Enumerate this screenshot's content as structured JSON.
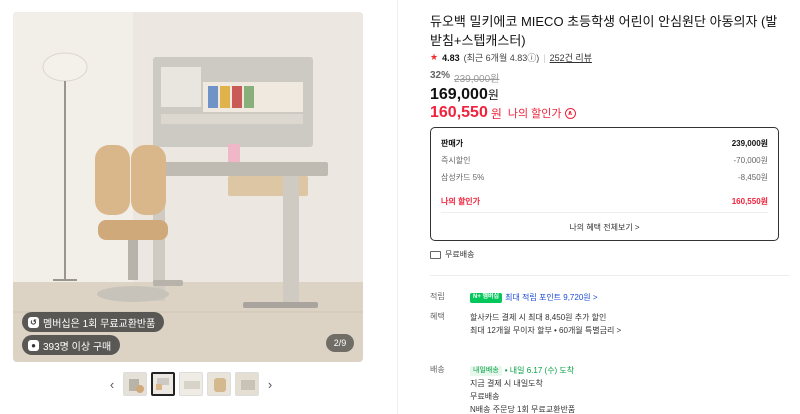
{
  "product": {
    "title": "듀오백 밀키에코 MIECO 초등학생 어린이 안심원단 아동의자 (발받침+스텝캐스터)",
    "rating_score": "4.83",
    "rating_detail": "(최근 6개월 4.83ⓘ)",
    "review_count": "252건 리뷰",
    "discount_rate": "32%",
    "original_price": "239,000원",
    "price_number": "169,000",
    "price_unit": "원",
    "my_price_number": "160,550",
    "my_price_unit": "원",
    "my_price_label": "나의 할인가"
  },
  "gallery": {
    "badge_membership": "멤버십은 1회 무료교환반품",
    "badge_buyers": "393명 이상 구매",
    "counter": "2/9",
    "thumb_count": 5,
    "active_thumb": 1
  },
  "price_box": {
    "rows": [
      {
        "label": "판매가",
        "value": "239,000원"
      },
      {
        "label": "즉시할인",
        "value": "-70,000원"
      },
      {
        "label": "삼성카드 5%",
        "value": "-8,450원"
      },
      {
        "label": "나의 할인가",
        "value": "160,550원"
      }
    ],
    "all_benefits": "나의 혜택 전체보기 >"
  },
  "shipping_free": "무료배송",
  "details": {
    "points_key": "적립",
    "points_badge": "N+ 멤버십",
    "points_text": "최대 적립 포인트 9,720원 >",
    "benefit_key": "혜택",
    "benefit_line1": "할사카드 결제 시 최대 8,450원 추가 할인",
    "benefit_line2": "최대 12개월 무이자 할부 • 60개월 특별금리 >",
    "delivery_key": "배송",
    "delivery_badge": "내일배송",
    "delivery_date": "• 내일 6.17 (수) 도착",
    "delivery_line2": "지금 결제 시 내일도착",
    "delivery_line3": "무료배송",
    "delivery_line4": "N배송 주문당 1회 무료교환반품"
  },
  "colors": {
    "accent_red": "#f0223c",
    "naver_green": "#03c75a",
    "link_blue": "#1b4bd4"
  }
}
